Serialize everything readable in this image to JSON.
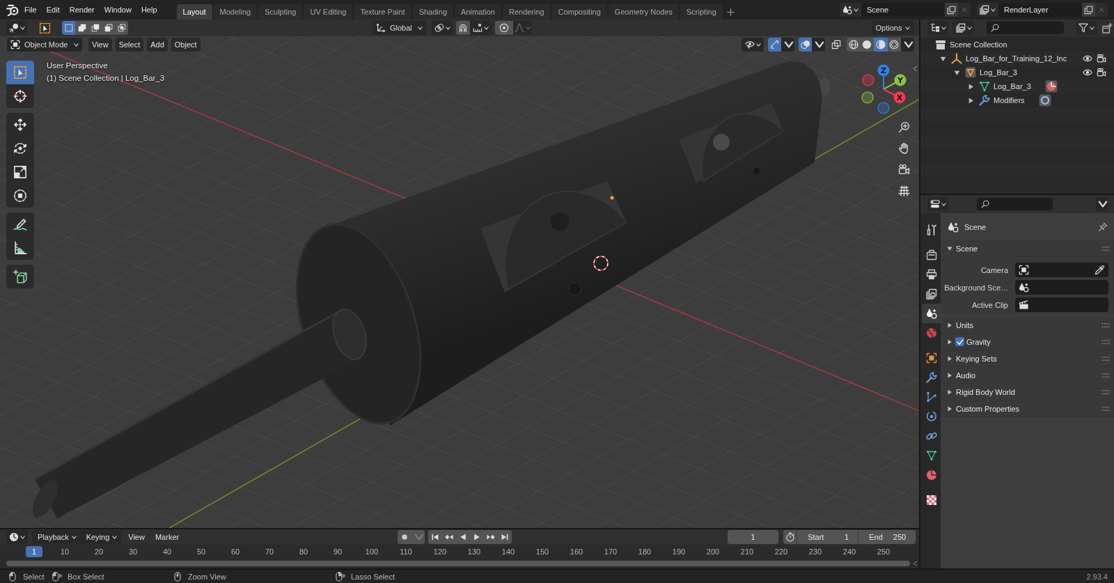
{
  "top_bar": {
    "menus": [
      "File",
      "Edit",
      "Render",
      "Window",
      "Help"
    ],
    "workspaces": [
      {
        "label": "Layout",
        "selected": true
      },
      {
        "label": "Modeling",
        "selected": false
      },
      {
        "label": "Sculpting",
        "selected": false
      },
      {
        "label": "UV Editing",
        "selected": false
      },
      {
        "label": "Texture Paint",
        "selected": false
      },
      {
        "label": "Shading",
        "selected": false
      },
      {
        "label": "Animation",
        "selected": false
      },
      {
        "label": "Rendering",
        "selected": false
      },
      {
        "label": "Compositing",
        "selected": false
      },
      {
        "label": "Geometry Nodes",
        "selected": false
      },
      {
        "label": "Scripting",
        "selected": false
      }
    ],
    "scene": "Scene",
    "view_layer": "RenderLayer"
  },
  "viewport": {
    "selection_modes": [
      {
        "kind": "new",
        "selected": true
      },
      {
        "kind": "extend",
        "selected": false
      },
      {
        "kind": "subtract",
        "selected": false
      },
      {
        "kind": "invert",
        "selected": false
      },
      {
        "kind": "intersect",
        "selected": false
      }
    ],
    "orientation": "Global",
    "snap": false,
    "proportional": false,
    "options": "Options",
    "mode": "Object Mode",
    "menus": [
      "View",
      "Select",
      "Add",
      "Object"
    ],
    "toggles": [
      {
        "kind": "gizmos",
        "on": true
      },
      {
        "kind": "overlays",
        "on": true
      },
      {
        "kind": "xray",
        "on": false
      }
    ],
    "shading": [
      {
        "kind": "wireframe",
        "selected": false
      },
      {
        "kind": "solid",
        "selected": false
      },
      {
        "kind": "material",
        "selected": true
      },
      {
        "kind": "rendered",
        "selected": false
      }
    ],
    "info": [
      "User Perspective",
      "(1) Scene Collection | Log_Bar_3"
    ],
    "toolbar": [
      {
        "tools": [
          {
            "kind": "select_box",
            "selected": true
          },
          {
            "kind": "cursor",
            "selected": false
          }
        ]
      },
      {
        "tools": [
          {
            "kind": "move",
            "selected": false
          },
          {
            "kind": "rotate",
            "selected": false
          },
          {
            "kind": "scale",
            "selected": false
          },
          {
            "kind": "transform",
            "selected": false
          }
        ]
      },
      {
        "tools": [
          {
            "kind": "annotate",
            "selected": false
          },
          {
            "kind": "measure",
            "selected": false
          }
        ]
      },
      {
        "tools": [
          {
            "kind": "add_cube",
            "selected": false
          }
        ]
      }
    ],
    "gizmo_axes": [
      {
        "label": "Z",
        "color": "#2e82e6"
      },
      {
        "label": "Y",
        "color": "#8bc43c"
      },
      {
        "label": "X",
        "color": "#f5384f"
      }
    ]
  },
  "outliner": {
    "root": "Scene Collection",
    "items": [
      {
        "label": "Log_Bar_for_Training_12_Inc",
        "kind": "empty",
        "expanded": true,
        "visible": true,
        "renderable": true,
        "children": [
          {
            "label": "Log_Bar_3",
            "kind": "object",
            "expanded": true,
            "visible": true,
            "renderable": true,
            "children": [
              {
                "label": "Log_Bar_3",
                "kind": "mesh",
                "expanded": false
              },
              {
                "label": "Modifiers",
                "kind": "modifiers",
                "expanded": false
              }
            ]
          }
        ]
      }
    ]
  },
  "properties": {
    "tab_groups": [
      {
        "tabs": [
          {
            "kind": "tool",
            "selected": false
          }
        ]
      },
      {
        "tabs": [
          {
            "kind": "render",
            "selected": false
          },
          {
            "kind": "output",
            "selected": false
          },
          {
            "kind": "view_layer",
            "selected": false
          },
          {
            "kind": "scene",
            "selected": true
          },
          {
            "kind": "world",
            "selected": false
          }
        ]
      },
      {
        "tabs": [
          {
            "kind": "object",
            "selected": false
          },
          {
            "kind": "modifiers",
            "selected": false
          },
          {
            "kind": "particles",
            "selected": false
          },
          {
            "kind": "physics",
            "selected": false
          },
          {
            "kind": "constraints",
            "selected": false
          },
          {
            "kind": "data",
            "selected": false
          },
          {
            "kind": "material",
            "selected": false
          }
        ]
      },
      {
        "tabs": [
          {
            "kind": "texture",
            "selected": false
          }
        ]
      }
    ],
    "context": "Scene",
    "panel": {
      "title": "Scene",
      "expanded": true,
      "fields": [
        {
          "label": "Camera",
          "kind": "object"
        },
        {
          "label": "Background Sce…",
          "kind": "scene"
        },
        {
          "label": "Active Clip",
          "kind": "clip"
        }
      ]
    },
    "sections": [
      {
        "title": "Units",
        "expanded": false
      },
      {
        "title": "Gravity",
        "expanded": false,
        "checked": true
      },
      {
        "title": "Keying Sets",
        "expanded": false
      },
      {
        "title": "Audio",
        "expanded": false
      },
      {
        "title": "Rigid Body World",
        "expanded": false
      },
      {
        "title": "Custom Properties",
        "expanded": false
      }
    ]
  },
  "timeline": {
    "menus": [
      {
        "label": "Playback",
        "kind": "dropdown"
      },
      {
        "label": "Keying",
        "kind": "dropdown"
      },
      {
        "label": "View",
        "kind": "menu"
      },
      {
        "label": "Marker",
        "kind": "menu"
      }
    ],
    "auto_keying": false,
    "current_frame": "1",
    "start": {
      "label": "Start",
      "value": "1"
    },
    "end": {
      "label": "End",
      "value": "250"
    },
    "ruler": [
      {
        "label": "1",
        "selected": true
      },
      {
        "label": "10",
        "selected": false
      },
      {
        "label": "20",
        "selected": false
      },
      {
        "label": "30",
        "selected": false
      },
      {
        "label": "40",
        "selected": false
      },
      {
        "label": "50",
        "selected": false
      },
      {
        "label": "60",
        "selected": false
      },
      {
        "label": "70",
        "selected": false
      },
      {
        "label": "80",
        "selected": false
      },
      {
        "label": "90",
        "selected": false
      },
      {
        "label": "100",
        "selected": false
      },
      {
        "label": "110",
        "selected": false
      },
      {
        "label": "120",
        "selected": false
      },
      {
        "label": "130",
        "selected": false
      },
      {
        "label": "140",
        "selected": false
      },
      {
        "label": "150",
        "selected": false
      },
      {
        "label": "160",
        "selected": false
      },
      {
        "label": "170",
        "selected": false
      },
      {
        "label": "180",
        "selected": false
      },
      {
        "label": "190",
        "selected": false
      },
      {
        "label": "200",
        "selected": false
      },
      {
        "label": "210",
        "selected": false
      },
      {
        "label": "220",
        "selected": false
      },
      {
        "label": "230",
        "selected": false
      },
      {
        "label": "240",
        "selected": false
      },
      {
        "label": "250",
        "selected": false
      }
    ]
  },
  "status_bar": {
    "hints": [
      {
        "kind": "left_click",
        "label": "Select"
      },
      {
        "kind": "left_drag",
        "label": "Box Select"
      },
      {
        "kind": "middle_click",
        "label": "Zoom View"
      },
      {
        "kind": "right_drag",
        "label": "Lasso Select"
      }
    ],
    "version": "2.93.4"
  }
}
